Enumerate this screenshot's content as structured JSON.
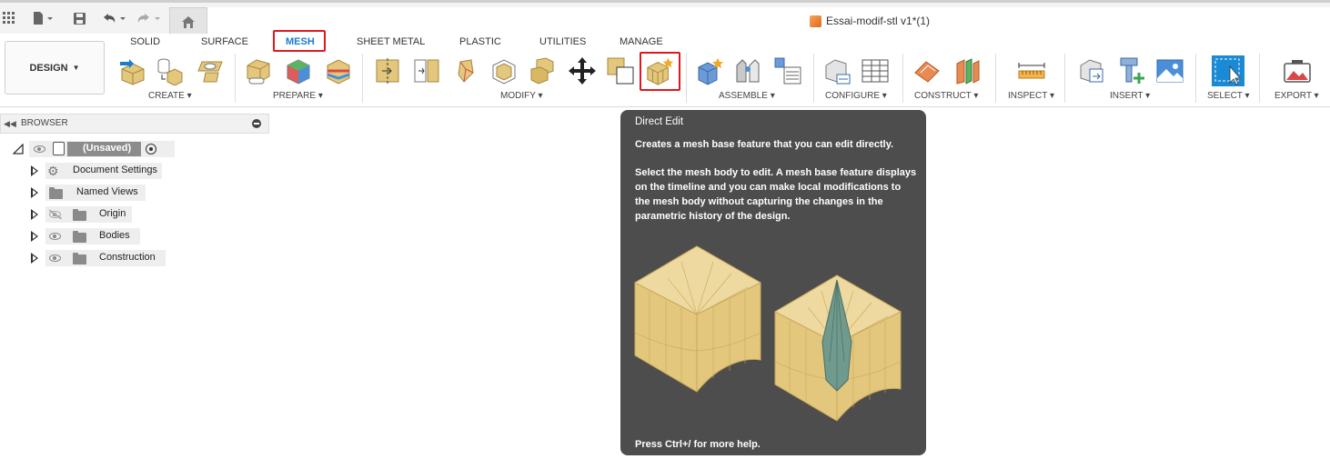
{
  "window": {
    "title": "Essai-modif-stl v1*(1)"
  },
  "workspace": {
    "label": "DESIGN"
  },
  "tabs": [
    {
      "label": "SOLID"
    },
    {
      "label": "SURFACE"
    },
    {
      "label": "MESH"
    },
    {
      "label": "SHEET METAL"
    },
    {
      "label": "PLASTIC"
    },
    {
      "label": "UTILITIES"
    },
    {
      "label": "MANAGE"
    }
  ],
  "groups": [
    {
      "label": "CREATE"
    },
    {
      "label": "PREPARE"
    },
    {
      "label": "MODIFY"
    },
    {
      "label": "ASSEMBLE"
    },
    {
      "label": "CONFIGURE"
    },
    {
      "label": "CONSTRUCT"
    },
    {
      "label": "INSPECT"
    },
    {
      "label": "INSERT"
    },
    {
      "label": "SELECT"
    },
    {
      "label": "EXPORT"
    }
  ],
  "browser": {
    "title": "BROWSER",
    "root": {
      "label": "(Unsaved)"
    },
    "items": [
      {
        "label": "Document Settings"
      },
      {
        "label": "Named Views"
      },
      {
        "label": "Origin"
      },
      {
        "label": "Bodies"
      },
      {
        "label": "Construction"
      }
    ]
  },
  "tooltip": {
    "title": "Direct Edit",
    "line1": "Creates a mesh base feature that you can edit directly.",
    "line2": "Select the mesh body to edit. A mesh base feature displays on the timeline and you can make local modifications to the mesh body without capturing the changes in the parametric history of the design.",
    "footer": "Press Ctrl+/ for more help."
  },
  "colors": {
    "active_tab": "#1b7bd0",
    "highlight": "#e0181e",
    "mesh_gold": "#e2c77c",
    "tooltip_bg": "#4d4d4d"
  }
}
